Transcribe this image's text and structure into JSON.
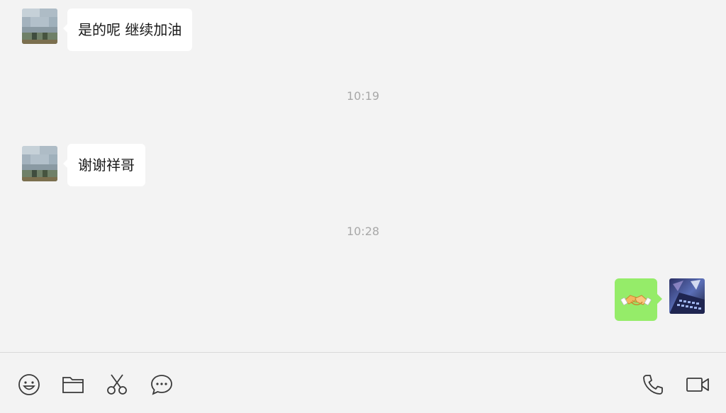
{
  "messages": [
    {
      "direction": "incoming",
      "text": "是的呢 继续加油"
    },
    {
      "timestamp": "10:19"
    },
    {
      "direction": "incoming",
      "text": "谢谢祥哥"
    },
    {
      "timestamp": "10:28"
    },
    {
      "direction": "outgoing",
      "emoji": "🤝"
    }
  ],
  "colors": {
    "background": "#f3f3f3",
    "incoming_bubble": "#ffffff",
    "outgoing_bubble": "#95ec69",
    "timestamp_text": "#a8a8a8",
    "icon_stroke": "#3a3a3a"
  },
  "toolbar": {
    "left_icons": [
      "emoji-icon",
      "folder-icon",
      "scissors-icon",
      "chat-bubble-icon"
    ],
    "right_icons": [
      "phone-icon",
      "video-camera-icon"
    ]
  }
}
